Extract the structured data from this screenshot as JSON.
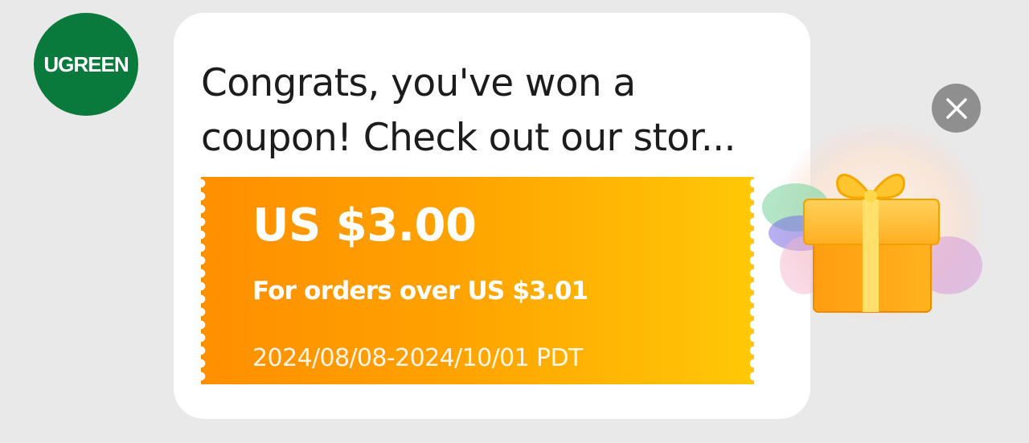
{
  "brand": {
    "logo_text": "UGREEN",
    "logo_color": "#0a7a3c"
  },
  "message": {
    "text": "Congrats, you've won a coupon! Check out our stor..."
  },
  "coupon": {
    "amount": "US $3.00",
    "condition": "For orders over US $3.01",
    "validity": "2024/08/08-2024/10/01 PDT",
    "gradient_start": "#ff8f00",
    "gradient_end": "#ffc807"
  },
  "controls": {
    "close_icon": "close-icon"
  },
  "decor": {
    "gift_icon": "gift-box-icon"
  }
}
